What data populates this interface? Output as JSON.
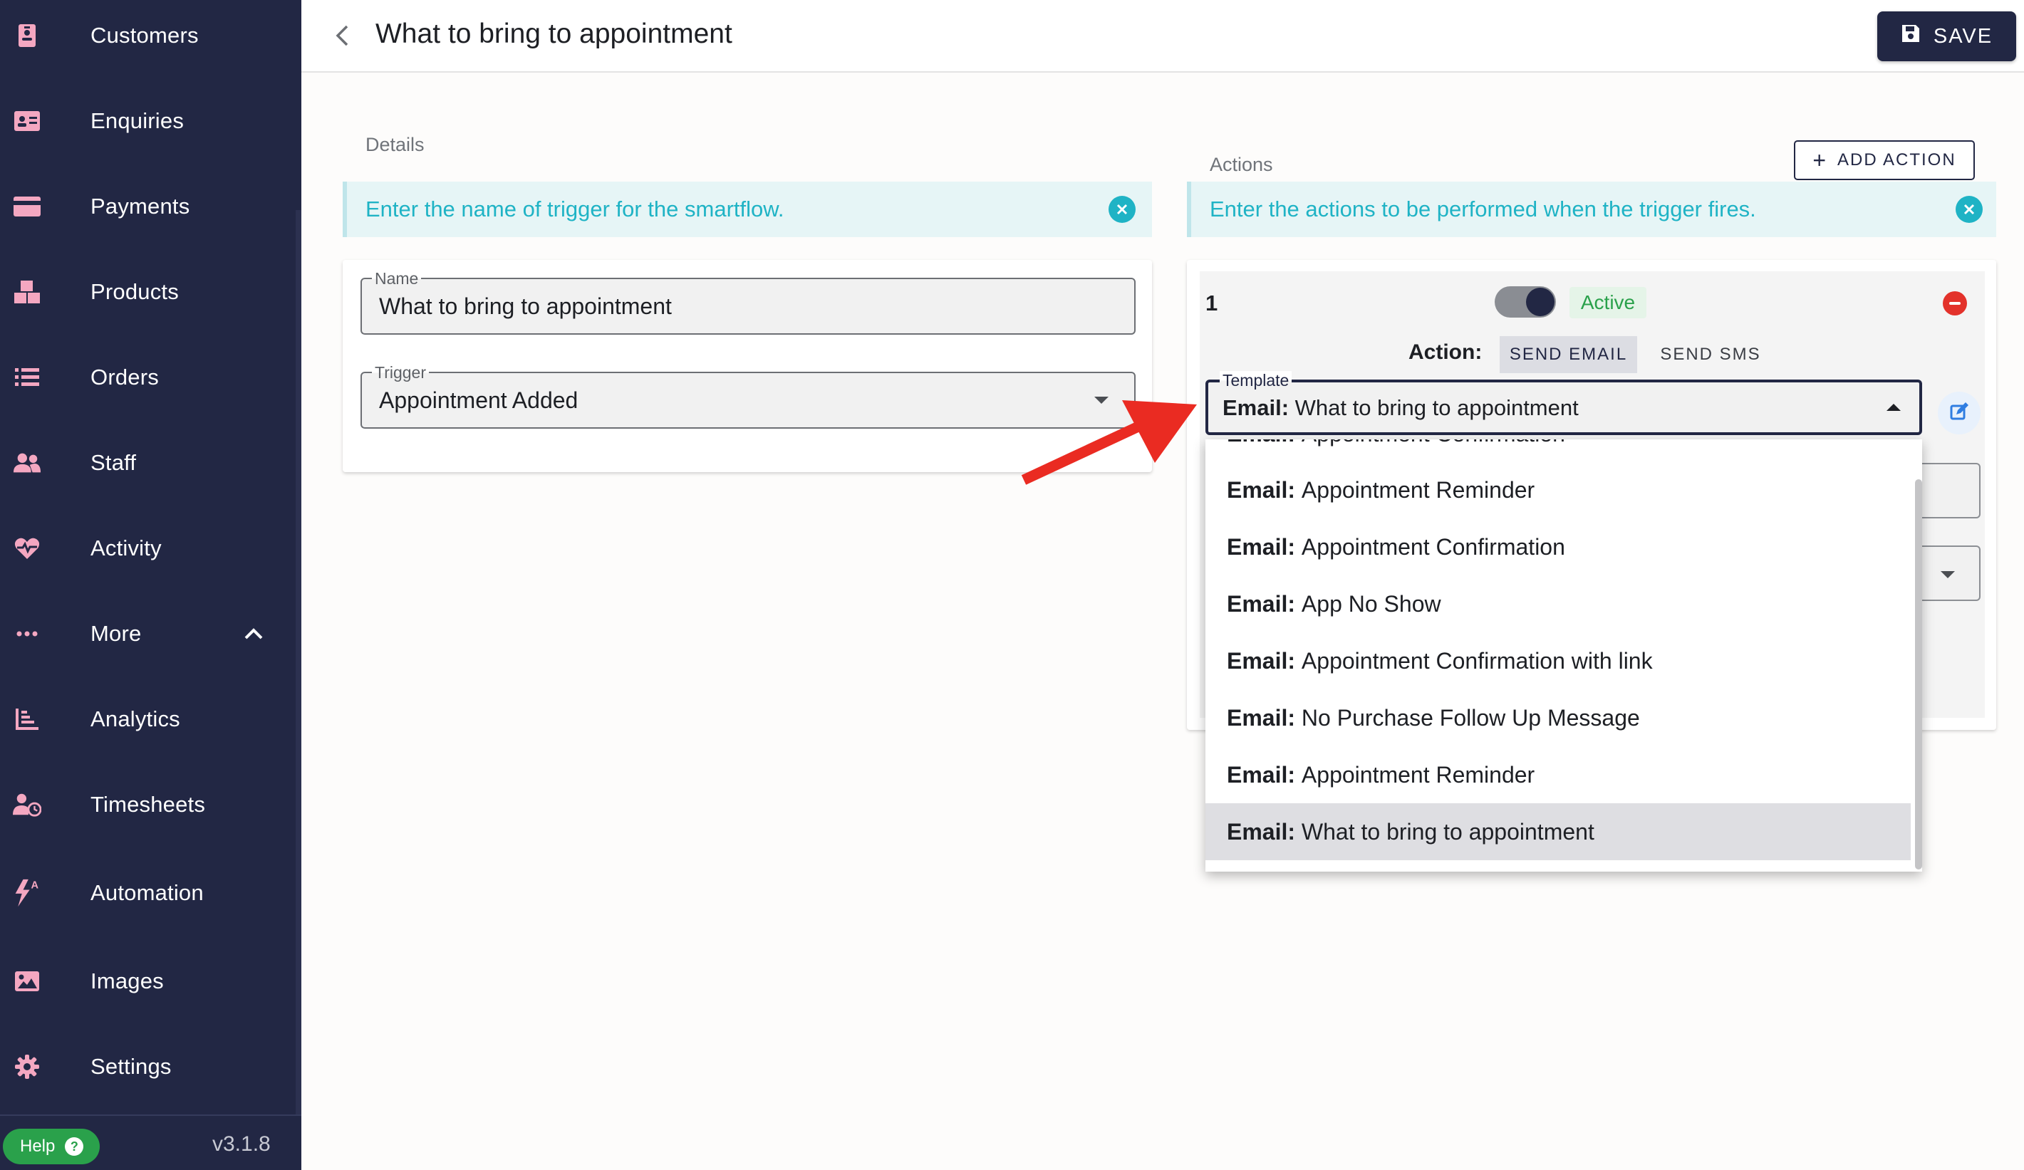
{
  "sidebar": {
    "items": [
      {
        "label": "Customers",
        "icon": "id-badge-icon"
      },
      {
        "label": "Enquiries",
        "icon": "address-card-icon"
      },
      {
        "label": "Payments",
        "icon": "credit-card-icon"
      },
      {
        "label": "Products",
        "icon": "boxes-icon"
      },
      {
        "label": "Orders",
        "icon": "list-icon"
      },
      {
        "label": "Staff",
        "icon": "users-icon"
      },
      {
        "label": "Activity",
        "icon": "heart-pulse-icon"
      },
      {
        "label": "More",
        "icon": "ellipsis-icon"
      },
      {
        "label": "Analytics",
        "icon": "chart-bar-icon"
      },
      {
        "label": "Timesheets",
        "icon": "user-clock-icon"
      },
      {
        "label": "Automation",
        "icon": "bolt-a-icon"
      },
      {
        "label": "Images",
        "icon": "image-icon"
      },
      {
        "label": "Settings",
        "icon": "cog-icon"
      }
    ],
    "help_label": "Help",
    "help_icon": "question-circle-icon",
    "version": "v3.1.8"
  },
  "header": {
    "title": "What to bring to appointment",
    "save_label": "SAVE"
  },
  "details": {
    "section_label": "Details",
    "banner_text": "Enter the name of trigger for the smartflow.",
    "name_label": "Name",
    "name_value": "What to bring to appointment",
    "trigger_label": "Trigger",
    "trigger_value": "Appointment Added"
  },
  "actions": {
    "section_label": "Actions",
    "add_action_label": "ADD ACTION",
    "banner_text": "Enter the actions to be performed when the trigger fires.",
    "action_number": "1",
    "active_label": "Active",
    "action_label": "Action:",
    "tab_email": "SEND EMAIL",
    "tab_sms": "SEND SMS",
    "template_label": "Template",
    "template_prefix": "Email:",
    "template_value": "What to bring to appointment"
  },
  "template_menu": {
    "items": [
      {
        "prefix": "Email:",
        "label": "Appointment Confirmation"
      },
      {
        "prefix": "Email:",
        "label": "Appointment Reminder"
      },
      {
        "prefix": "Email:",
        "label": "Appointment Confirmation"
      },
      {
        "prefix": "Email:",
        "label": "App No Show"
      },
      {
        "prefix": "Email:",
        "label": "Appointment Confirmation with link"
      },
      {
        "prefix": "Email:",
        "label": "No Purchase Follow Up Message"
      },
      {
        "prefix": "Email:",
        "label": "Appointment Reminder"
      },
      {
        "prefix": "Email:",
        "label": "What to bring to appointment"
      }
    ],
    "selected_index": 7
  },
  "colors": {
    "sidebar_bg": "#222744",
    "nav_icon": "#f4a7c1",
    "banner_text": "#1fb3c5",
    "active_green": "#2aa14b",
    "remove_red": "#e3322b",
    "arrow_red": "#ea2b22"
  }
}
